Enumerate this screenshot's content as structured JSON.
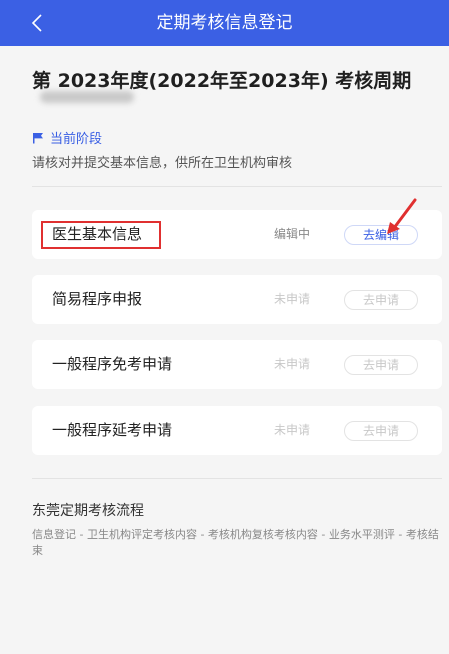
{
  "navbar": {
    "back_icon": "chevron-left-icon",
    "title": "定期考核信息登记",
    "background": "#3b60e4"
  },
  "header": {
    "period_title": "第 2023年度(2022年至2023年) 考核周期"
  },
  "stage": {
    "icon": "flag-icon",
    "label": "当前阶段",
    "description": "请核对并提交基本信息，供所在卫生机构审核"
  },
  "items": [
    {
      "name": "医生基本信息",
      "status": "编辑中",
      "action": "去编辑",
      "enabled": true
    },
    {
      "name": "简易程序申报",
      "status": "未申请",
      "action": "去申请",
      "enabled": false
    },
    {
      "name": "一般程序免考申请",
      "status": "未申请",
      "action": "去申请",
      "enabled": false
    },
    {
      "name": "一般程序延考申请",
      "status": "未申请",
      "action": "去申请",
      "enabled": false
    }
  ],
  "flow": {
    "title": "东莞定期考核流程",
    "description": "信息登记 - 卫生机构评定考核内容 - 考核机构复核考核内容 - 业务水平测评 - 考核结束"
  },
  "colors": {
    "accent": "#3b60e4",
    "highlight": "#e03030"
  }
}
